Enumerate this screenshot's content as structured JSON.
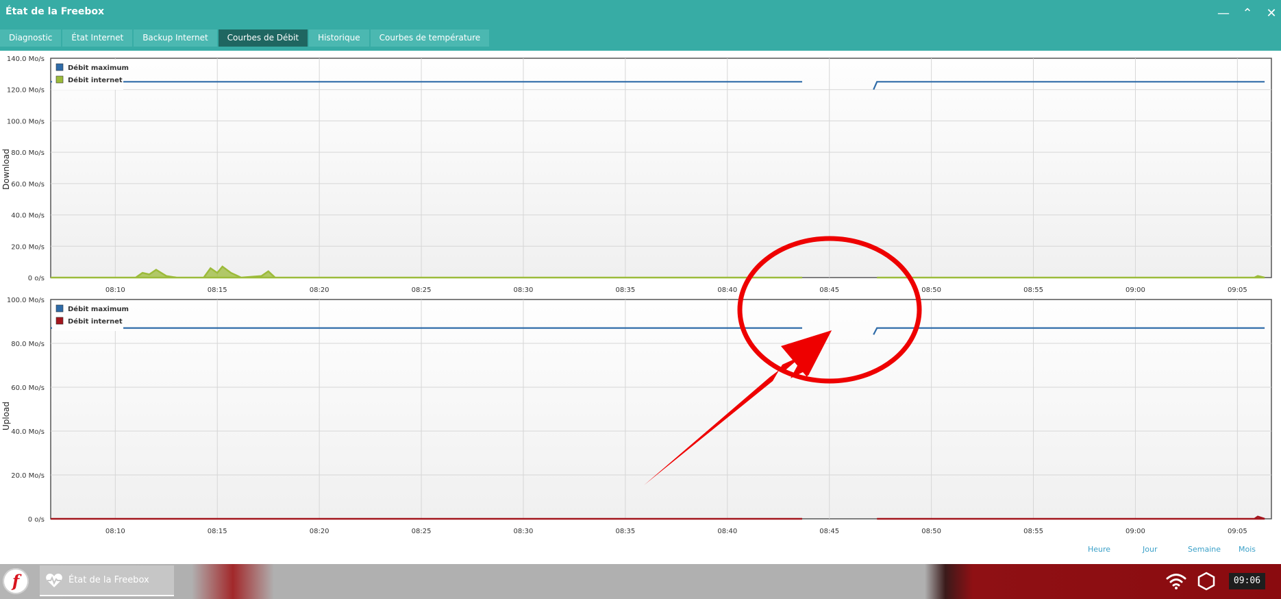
{
  "window": {
    "title": "État de la Freebox",
    "controls": [
      {
        "name": "minimize-button",
        "icon": "minimize-icon",
        "glyph": "—"
      },
      {
        "name": "restore-button",
        "icon": "restore-icon",
        "glyph": "⌃"
      },
      {
        "name": "close-button",
        "icon": "close-icon",
        "glyph": "✕"
      }
    ]
  },
  "tabs": [
    {
      "label": "Diagnostic",
      "active": false
    },
    {
      "label": "État Internet",
      "active": false
    },
    {
      "label": "Backup Internet",
      "active": false
    },
    {
      "label": "Courbes de Débit",
      "active": true
    },
    {
      "label": "Historique",
      "active": false
    },
    {
      "label": "Courbes de température",
      "active": false
    }
  ],
  "range_links": [
    "Heure",
    "Jour",
    "Semaine",
    "Mois"
  ],
  "taskbar": {
    "start_logo": "f",
    "task_label": "État de la Freebox",
    "task_icon": "heart-pulse-icon",
    "wifi_icon": "wifi-icon",
    "network_icon": "hexagon-icon",
    "clock": "09:06"
  },
  "colors": {
    "titlebar": "#37aca5",
    "tab_active": "#1f6661",
    "max_line": "#2e6ba8",
    "download_fill": "#9cbb3a",
    "upload_fill": "#a3151d",
    "annotation": "#ee0000"
  },
  "chart_data": [
    {
      "type": "area",
      "ylabel": "Download",
      "xlabel": "",
      "ylim": [
        0,
        140
      ],
      "yticks": [
        "0 o/s",
        "20.0 Mo/s",
        "40.0 Mo/s",
        "60.0 Mo/s",
        "80.0 Mo/s",
        "100.0 Mo/s",
        "120.0 Mo/s",
        "140.0 Mo/s"
      ],
      "xticks": [
        "08:10",
        "08:15",
        "08:20",
        "08:25",
        "08:30",
        "08:35",
        "08:40",
        "08:45",
        "08:50",
        "08:55",
        "09:00",
        "09:05"
      ],
      "xlim": [
        "08:06:50",
        "09:06:40"
      ],
      "grid": true,
      "legend_position": "top-left",
      "series": [
        {
          "name": "Débit maximum",
          "kind": "line",
          "color": "#2e6ba8",
          "segments": [
            [
              [
                "08:06:50",
                125
              ],
              [
                "08:43:40",
                125
              ]
            ],
            [
              [
                "08:47:10",
                120
              ],
              [
                "08:47:20",
                125
              ],
              [
                "09:06:20",
                125
              ]
            ]
          ]
        },
        {
          "name": "Débit internet",
          "kind": "area",
          "color": "#9cbb3a",
          "segments": [
            [
              [
                "08:06:50",
                0
              ],
              [
                "08:11:00",
                0
              ],
              [
                "08:11:20",
                3
              ],
              [
                "08:11:40",
                2
              ],
              [
                "08:12:00",
                5
              ],
              [
                "08:12:30",
                1
              ],
              [
                "08:13:00",
                0
              ],
              [
                "08:14:20",
                0
              ],
              [
                "08:14:40",
                6
              ],
              [
                "08:15:00",
                3
              ],
              [
                "08:15:15",
                7
              ],
              [
                "08:15:40",
                3
              ],
              [
                "08:16:10",
                0
              ],
              [
                "08:17:10",
                1
              ],
              [
                "08:17:30",
                4
              ],
              [
                "08:17:50",
                0
              ],
              [
                "08:43:40",
                0
              ]
            ],
            [
              [
                "08:47:20",
                0
              ],
              [
                "09:05:50",
                0
              ],
              [
                "09:06:00",
                1
              ],
              [
                "09:06:20",
                0
              ]
            ]
          ]
        }
      ]
    },
    {
      "type": "area",
      "ylabel": "Upload",
      "xlabel": "",
      "ylim": [
        0,
        100
      ],
      "yticks": [
        "0 o/s",
        "20.0 Mo/s",
        "40.0 Mo/s",
        "60.0 Mo/s",
        "80.0 Mo/s",
        "100.0 Mo/s"
      ],
      "xticks": [
        "08:10",
        "08:15",
        "08:20",
        "08:25",
        "08:30",
        "08:35",
        "08:40",
        "08:45",
        "08:50",
        "08:55",
        "09:00",
        "09:05"
      ],
      "xlim": [
        "08:06:50",
        "09:06:40"
      ],
      "grid": true,
      "legend_position": "top-left",
      "series": [
        {
          "name": "Débit maximum",
          "kind": "line",
          "color": "#2e6ba8",
          "segments": [
            [
              [
                "08:06:50",
                87
              ],
              [
                "08:43:40",
                87
              ]
            ],
            [
              [
                "08:47:10",
                84
              ],
              [
                "08:47:20",
                87
              ],
              [
                "09:06:20",
                87
              ]
            ]
          ]
        },
        {
          "name": "Débit internet",
          "kind": "area",
          "color": "#a3151d",
          "segments": [
            [
              [
                "08:06:50",
                0
              ],
              [
                "08:43:40",
                0
              ]
            ],
            [
              [
                "08:47:20",
                0
              ],
              [
                "09:05:50",
                0
              ],
              [
                "09:06:00",
                1
              ],
              [
                "09:06:20",
                0
              ]
            ]
          ]
        }
      ]
    }
  ]
}
